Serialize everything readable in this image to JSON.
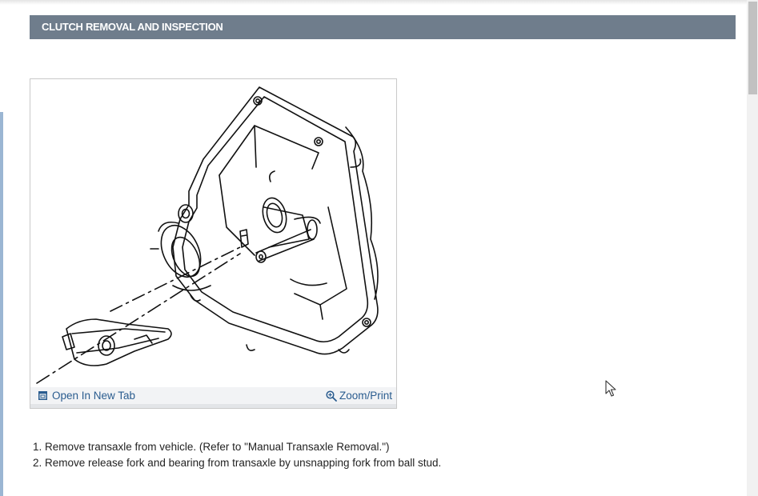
{
  "section": {
    "title": "CLUTCH REMOVAL AND INSPECTION"
  },
  "figure": {
    "open_tab_label": "Open In New Tab",
    "zoom_label": "Zoom/Print"
  },
  "steps": [
    "1. Remove transaxle from vehicle. (Refer to \"Manual Transaxle Removal.\")",
    "2. Remove release fork and bearing from transaxle by unsnapping fork from ball stud."
  ],
  "icons": {
    "open_tab": "open-in-new-tab-icon",
    "zoom": "zoom-magnifier-icon",
    "cursor": "mouse-pointer-icon"
  },
  "colors": {
    "header_bg": "#6f7d8c",
    "header_text": "#ffffff",
    "link": "#2a5c8f",
    "body_text": "#222222"
  }
}
